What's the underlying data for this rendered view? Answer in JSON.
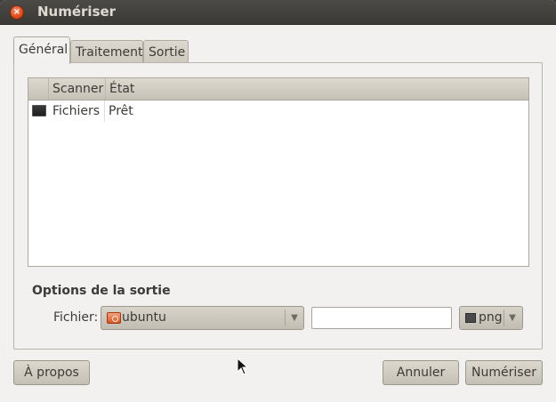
{
  "window": {
    "title": "Numériser",
    "close_glyph": "×"
  },
  "tabs": [
    {
      "label": "Général",
      "active": true
    },
    {
      "label": "Traitement",
      "active": false
    },
    {
      "label": "Sortie",
      "active": false
    }
  ],
  "scanner_list": {
    "columns": [
      "",
      "Scanner",
      "État"
    ],
    "rows": [
      {
        "icon": "scanner-icon",
        "scanner": "Fichiers",
        "state": "Prêt"
      }
    ]
  },
  "output_options": {
    "section_title": "Options de la sortie",
    "file_label": "Fichier:",
    "folder": {
      "icon": "folder-icon",
      "value": "ubuntu"
    },
    "filename_value": "",
    "format": {
      "icon": "image-icon",
      "value": "png"
    }
  },
  "buttons": {
    "about": "À propos",
    "cancel": "Annuler",
    "scan": "Numériser"
  },
  "colors": {
    "accent": "#df4a16",
    "background": "#f2f1f0",
    "titlebar": "#3c3b37"
  }
}
